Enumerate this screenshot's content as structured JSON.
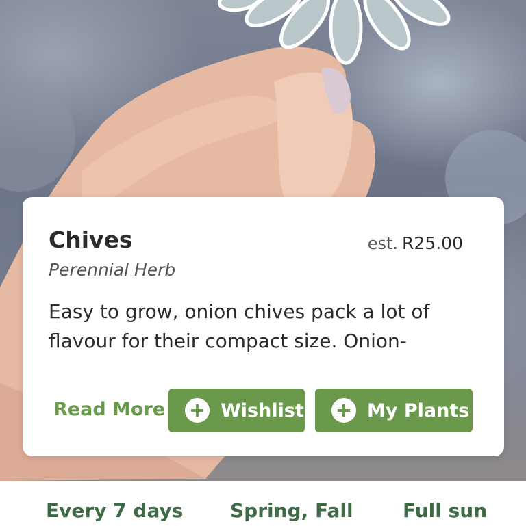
{
  "plant": {
    "name": "Chives",
    "type": "Perennial Herb",
    "price_prefix": "est.",
    "price": "R25.00",
    "description": "Easy to grow, onion chives pack a lot of flavour for their compact size. Onion-"
  },
  "actions": {
    "read_more": "Read More",
    "wishlist": "Wishlist",
    "my_plants": "My Plants"
  },
  "care": {
    "watering": "Every 7 days",
    "season": "Spring, Fall",
    "sun": "Full sun"
  },
  "icons": {
    "wishlist": "plus-circle-icon",
    "my_plants": "plus-circle-icon"
  },
  "colors": {
    "accent_green": "#6b994c",
    "info_green": "#3e6b46",
    "text_dark": "#2b2b2b"
  }
}
